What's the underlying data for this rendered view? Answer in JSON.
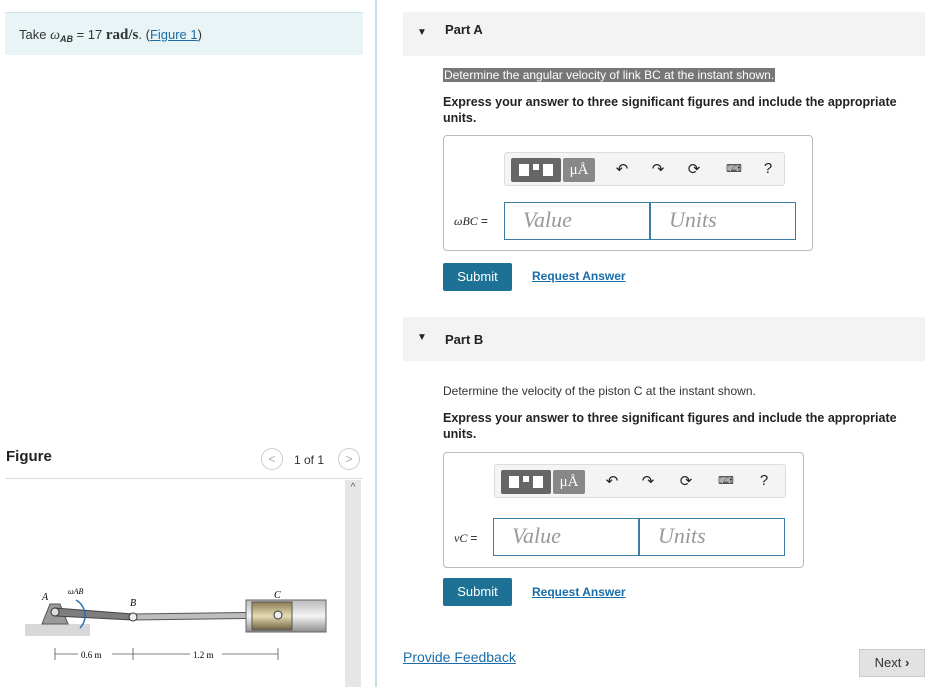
{
  "given": {
    "prefix": "Take ",
    "symbol": "ω",
    "subscript": "AB",
    "equals": " = 17 ",
    "unit": "rad/s",
    "period": ". (",
    "figure_link": "Figure 1",
    "close": ")"
  },
  "figure_panel": {
    "title": "Figure",
    "counter": "1 of 1",
    "prev": "<",
    "next": ">",
    "scroll_up": "^"
  },
  "figure": {
    "label_A": "A",
    "label_omega": "ωAB",
    "label_B": "B",
    "label_C": "C",
    "dim1": "0.6 m",
    "dim2": "1.2 m"
  },
  "partA": {
    "title": "Part A",
    "question": "Determine the angular velocity of link BC at the instant shown.",
    "instructions": "Express your answer to three significant figures and include the appropriate units.",
    "var_label": "ωBC",
    "equals": "=",
    "value_placeholder": "Value",
    "units_placeholder": "Units",
    "submit": "Submit",
    "request": "Request Answer"
  },
  "partB": {
    "title": "Part B",
    "question": "Determine the velocity of the piston C at the instant shown.",
    "instructions": "Express your answer to three significant figures and include the appropriate units.",
    "var_label": "vC",
    "equals": "=",
    "value_placeholder": "Value",
    "units_placeholder": "Units",
    "submit": "Submit",
    "request": "Request Answer"
  },
  "toolbar": {
    "units_button": "μÅ",
    "help": "?",
    "undo": "↶",
    "redo": "↷",
    "reset": "⟳"
  },
  "footer": {
    "feedback": "Provide Feedback",
    "next": "Next"
  },
  "colors": {
    "accent": "#1d7194",
    "link": "#1a6ca8",
    "given_bg": "#e8f4f6"
  }
}
